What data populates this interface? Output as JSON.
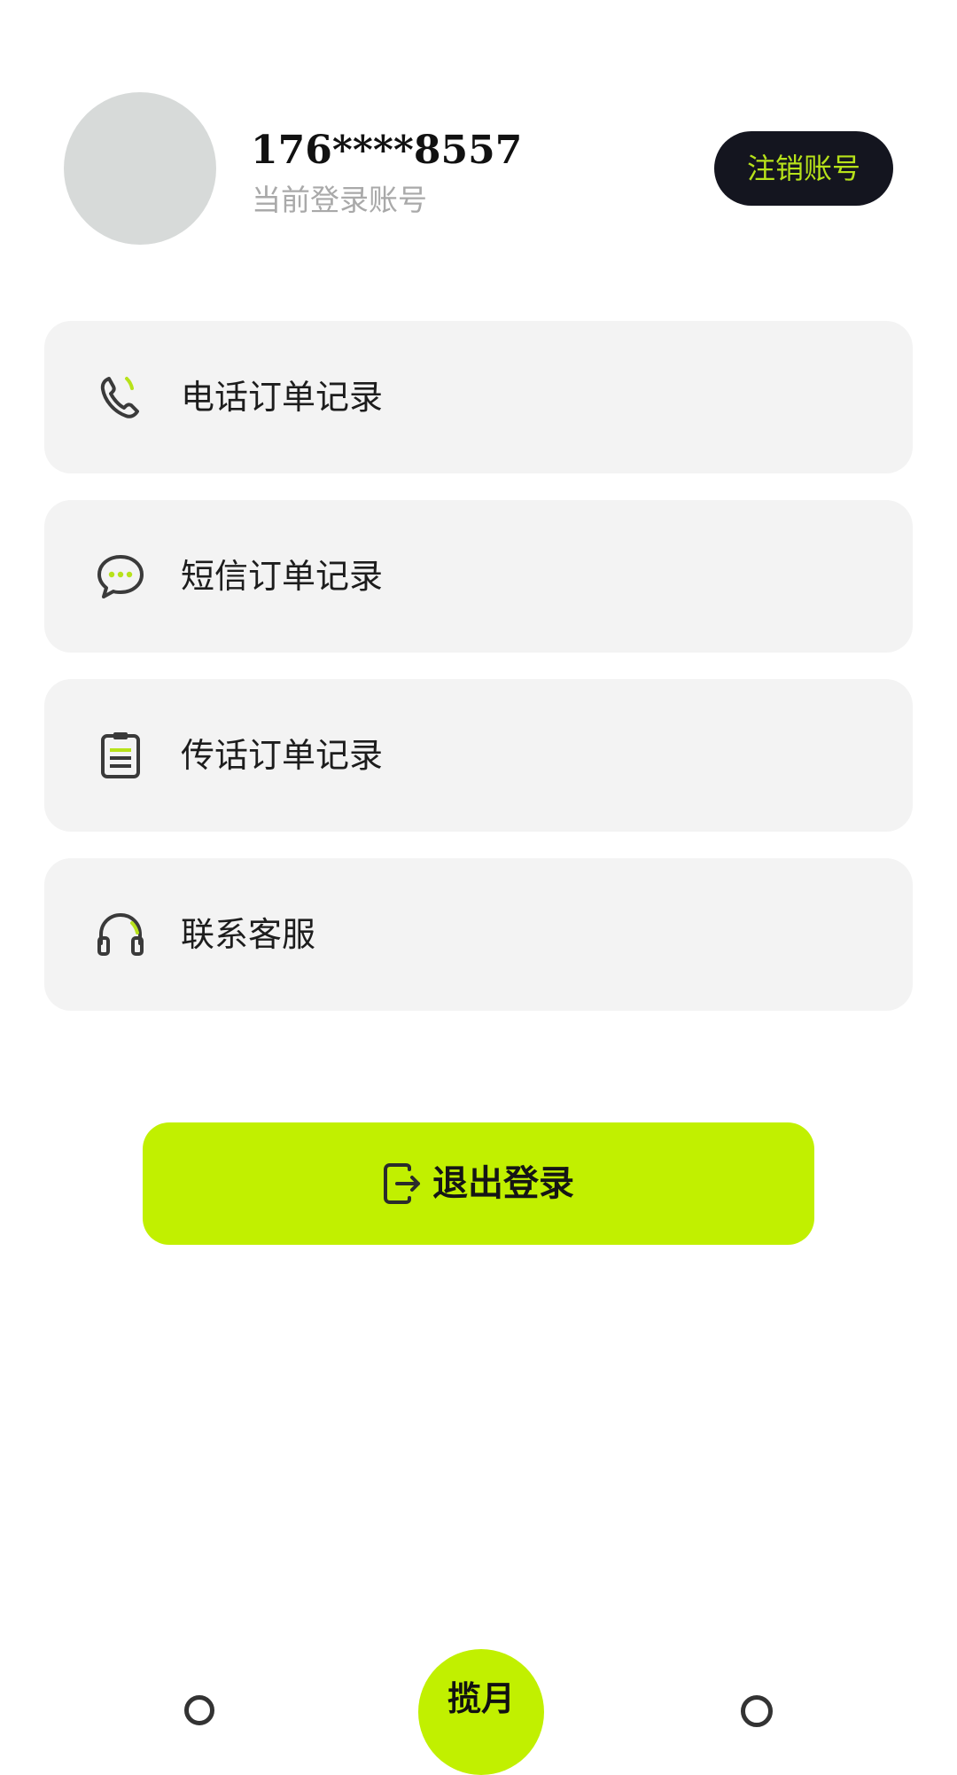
{
  "profile": {
    "phone": "176****8557",
    "subtitle": "当前登录账号",
    "deregister_label": "注销账号"
  },
  "menu": [
    {
      "label": "电话订单记录",
      "icon": "phone-icon"
    },
    {
      "label": "短信订单记录",
      "icon": "chat-bubble-icon"
    },
    {
      "label": "传话订单记录",
      "icon": "clipboard-icon"
    },
    {
      "label": "联系客服",
      "icon": "headset-icon"
    }
  ],
  "logout": {
    "label": "退出登录",
    "icon": "logout-icon"
  },
  "tabbar": {
    "center_label": "揽月"
  },
  "colors": {
    "accent": "#c1f000",
    "accent_text": "#b7e21a",
    "dark": "#14151f",
    "card_bg": "#f3f3f3",
    "avatar_bg": "#d7dad9",
    "muted_text": "#a9a9a9"
  }
}
